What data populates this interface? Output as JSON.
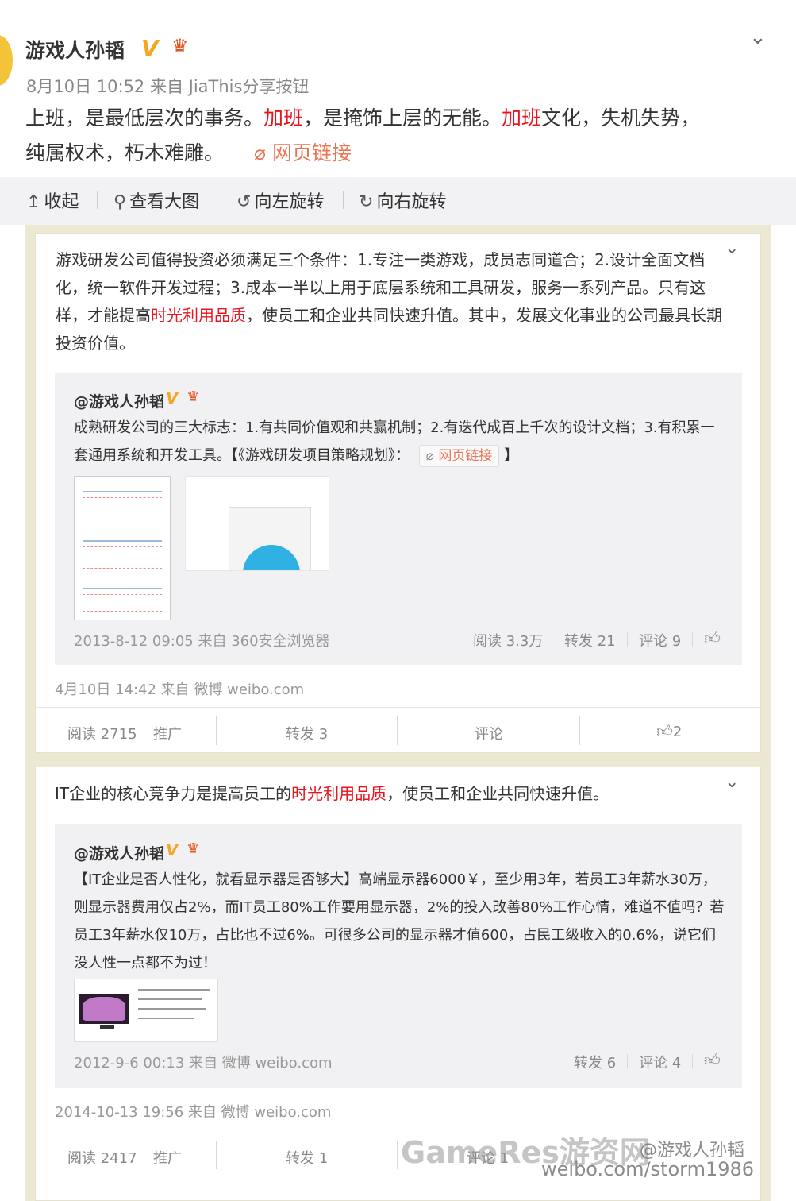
{
  "post": {
    "author": "游戏人孙韬",
    "verified_badge": "V",
    "meta": "8月10日 10:52 来自 JiaThis分享按钮",
    "text_parts": [
      "上班，是最低层次的事务。",
      "加班",
      "，是掩饰上层的无能。",
      "加班",
      "文化，失机失势，",
      "纯属权术，朽木难雕。"
    ],
    "link_label": "网页链接",
    "colors": {
      "highlight": "#e8141e",
      "link": "#eb7350",
      "badge": "#f5a623"
    }
  },
  "toolbar": {
    "collapse": "收起",
    "view_large": "查看大图",
    "rotate_left": "向左旋转",
    "rotate_right": "向右旋转"
  },
  "card1": {
    "text_a": "游戏研发公司值得投资必须满足三个条件：1.专注一类游戏，成员志同道合；2.设计全面文档化，统一软件开发过程；3.成本一半以上用于底层系统和工具研发，服务一系列产品。只有这样，才能提高",
    "highlight": "时光利用品质",
    "text_b": "，使员工和企业共同快速升值。其中，发展文化事业的公司最具长期投资价值。",
    "quote": {
      "author": "@游戏人孙韬",
      "text": "成熟研发公司的三大标志：1.有共同价值观和共赢机制；2.有迭代成百上千次的设计文档；3.有积累一套通用系统和开发工具。【《游戏研发项目策略规划》：",
      "link_label": "网页链接",
      "closing": "】",
      "meta": "2013-8-12 09:05 来自 360安全浏览器",
      "reads": "阅读 3.3万",
      "reposts": "转发 21",
      "comments": "评论 9"
    },
    "meta": "4月10日 14:42 来自 微博 weibo.com",
    "footer": {
      "reads": "阅读 2715",
      "promote": "推广",
      "repost": "转发 3",
      "comment": "评论",
      "likes": "2"
    }
  },
  "card2": {
    "text_a": "IT企业的核心竞争力是提高员工的",
    "highlight": "时光利用品质",
    "text_b": "，使员工和企业共同快速升值。",
    "quote": {
      "author": "@游戏人孙韬",
      "text": "【IT企业是否人性化，就看显示器是否够大】高端显示器6000￥，至少用3年，若员工3年薪水30万，则显示器费用仅占2%，而IT员工80%工作要用显示器，2%的投入改善80%工作心情，难道不值吗？若员工3年薪水仅10万，占比也不过6%。可很多公司的显示器才值600，占民工级收入的0.6%，说它们没人性一点都不为过！",
      "meta": "2012-9-6 00:13 来自 微博 weibo.com",
      "reposts": "转发 6",
      "comments": "评论 4"
    },
    "meta": "2014-10-13 19:56 来自 微博 weibo.com",
    "footer": {
      "reads": "阅读 2417",
      "promote": "推广",
      "repost": "转发 1",
      "comment": "评论 1"
    }
  },
  "watermark": {
    "site": "GameRes游资网",
    "handle": "@游戏人孙韬",
    "url": "weibo.com/storm1986"
  }
}
